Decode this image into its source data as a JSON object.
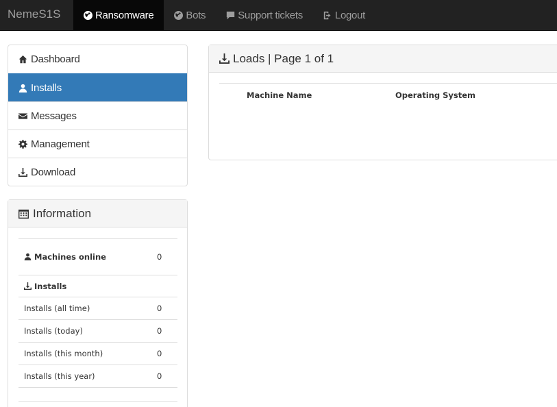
{
  "navbar": {
    "brand": "NemeS1S",
    "items": [
      {
        "label": "Ransomware",
        "icon": "globe-icon",
        "active": true
      },
      {
        "label": "Bots",
        "icon": "globe-icon",
        "active": false
      },
      {
        "label": "Support tickets",
        "icon": "comment-icon",
        "active": false
      },
      {
        "label": "Logout",
        "icon": "logout-icon",
        "active": false
      }
    ]
  },
  "sidebar": {
    "items": [
      {
        "label": "Dashboard",
        "icon": "home-icon"
      },
      {
        "label": "Installs",
        "icon": "user-icon",
        "active": true
      },
      {
        "label": "Messages",
        "icon": "envelope-icon"
      },
      {
        "label": "Management",
        "icon": "gear-icon"
      },
      {
        "label": "Download",
        "icon": "download-icon"
      }
    ]
  },
  "information": {
    "title": "Information",
    "machines_online_label": "Machines online",
    "machines_online_value": "0",
    "installs_heading": "Installs",
    "rows": [
      {
        "label": "Installs (all time)",
        "value": "0"
      },
      {
        "label": "Installs (today)",
        "value": "0"
      },
      {
        "label": "Installs (this month)",
        "value": "0"
      },
      {
        "label": "Installs (this year)",
        "value": "0"
      }
    ]
  },
  "loads": {
    "title": "Loads | Page 1 of 1",
    "columns": [
      "Machine Name",
      "Operating System"
    ]
  },
  "colors": {
    "navbar_bg": "#222222",
    "active_blue": "#337ab7",
    "panel_heading_bg": "#f5f5f5"
  }
}
